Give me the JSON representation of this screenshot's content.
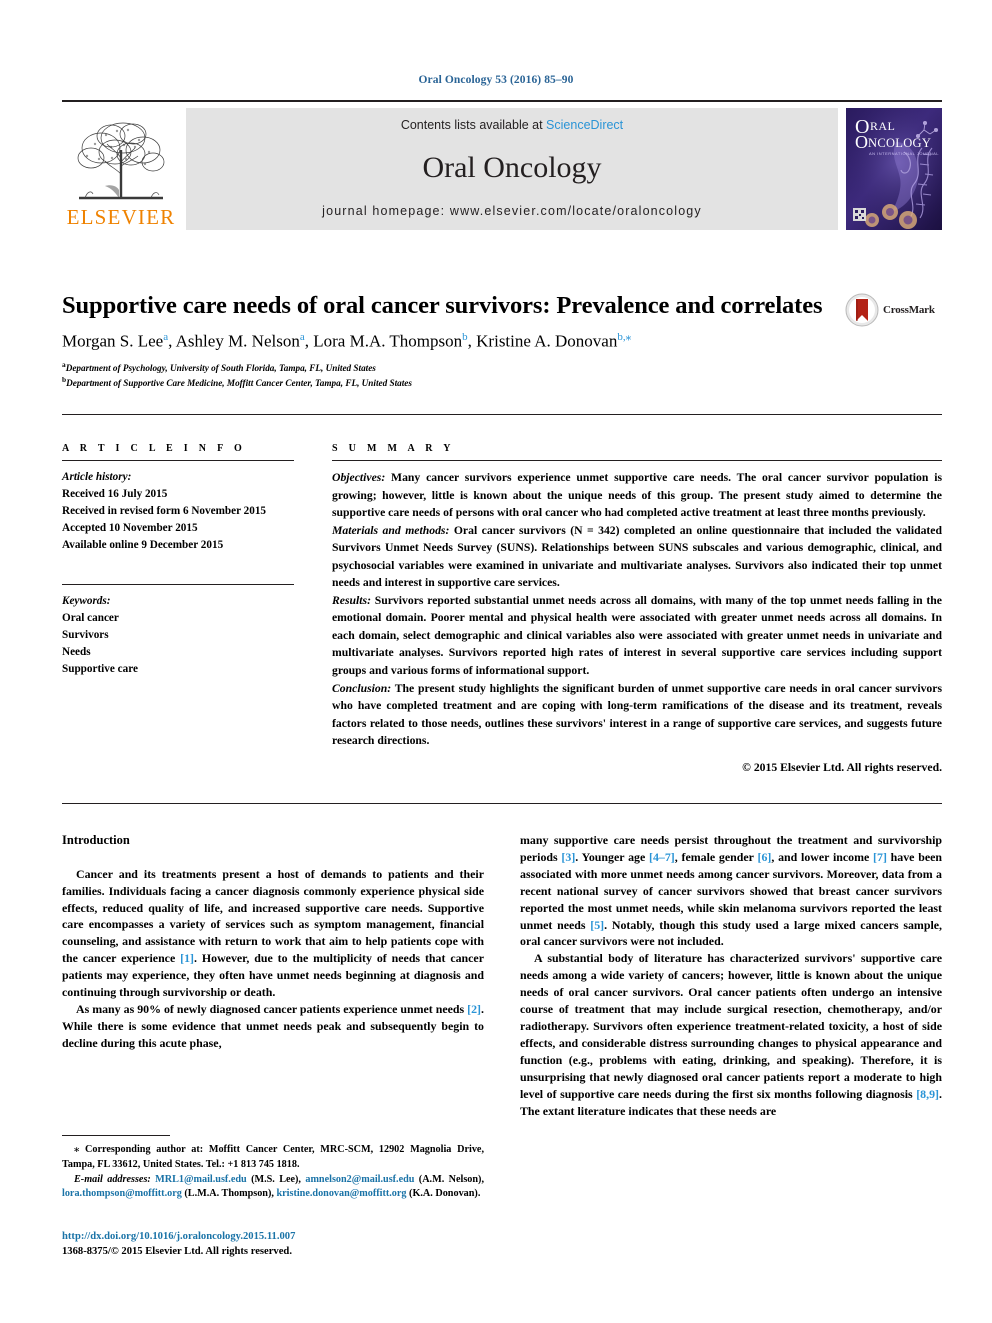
{
  "running_head": "Oral Oncology 53 (2016) 85–90",
  "masthead": {
    "contents_prefix": "Contents lists available at ",
    "contents_link": "ScienceDirect",
    "journal_name": "Oral Oncology",
    "homepage": "journal homepage: www.elsevier.com/locate/oraloncology",
    "publisher_word": "ELSEVIER",
    "cover_line1": "RAL",
    "cover_line2": "NCOLOGY",
    "cover_tagline": "AN INTERNATIONAL JOURNAL",
    "band_color": "#e3e3e3",
    "link_color": "#2a94d6",
    "publisher_color": "#ef8200"
  },
  "article": {
    "title": "Supportive care needs of oral cancer survivors: Prevalence and correlates",
    "crossmark_label": "CrossMark",
    "authors": [
      {
        "name": "Morgan S. Lee",
        "mark": "a",
        "sep": ", "
      },
      {
        "name": "Ashley M. Nelson",
        "mark": "a",
        "sep": ", "
      },
      {
        "name": "Lora M.A. Thompson",
        "mark": "b",
        "sep": ", "
      },
      {
        "name": "Kristine A. Donovan",
        "mark": "b,⁎",
        "sep": ""
      }
    ],
    "affiliations": [
      {
        "mark": "a",
        "text": "Department of Psychology, University of South Florida, Tampa, FL, United States"
      },
      {
        "mark": "b",
        "text": "Department of Supportive Care Medicine, Moffitt Cancer Center, Tampa, FL, United States"
      }
    ]
  },
  "info": {
    "heading": "A R T I C L E  I N F O",
    "history_label": "Article history:",
    "history": [
      "Received 16 July 2015",
      "Received in revised form 6 November 2015",
      "Accepted 10 November 2015",
      "Available online 9 December 2015"
    ],
    "keywords_label": "Keywords:",
    "keywords": [
      "Oral cancer",
      "Survivors",
      "Needs",
      "Supportive care"
    ]
  },
  "summary": {
    "heading": "S U M M A R Y",
    "objectives_label": "Objectives:",
    "objectives": " Many cancer survivors experience unmet supportive care needs. The oral cancer survivor population is growing; however, little is known about the unique needs of this group. The present study aimed to determine the supportive care needs of persons with oral cancer who had completed active treatment at least three months previously.",
    "methods_label": "Materials and methods:",
    "methods": " Oral cancer survivors (N = 342) completed an online questionnaire that included the validated Survivors Unmet Needs Survey (SUNS). Relationships between SUNS subscales and various demographic, clinical, and psychosocial variables were examined in univariate and multivariate analyses. Survivors also indicated their top unmet needs and interest in supportive care services.",
    "results_label": "Results:",
    "results": " Survivors reported substantial unmet needs across all domains, with many of the top unmet needs falling in the emotional domain. Poorer mental and physical health were associated with greater unmet needs across all domains. In each domain, select demographic and clinical variables also were associated with greater unmet needs in univariate and multivariate analyses. Survivors reported high rates of interest in several supportive care services including support groups and various forms of informational support.",
    "conclusion_label": "Conclusion:",
    "conclusion": " The present study highlights the significant burden of unmet supportive care needs in oral cancer survivors who have completed treatment and are coping with long-term ramifications of the disease and its treatment, reveals factors related to those needs, outlines these survivors' interest in a range of supportive care services, and suggests future research directions.",
    "copyright": "© 2015 Elsevier Ltd. All rights reserved."
  },
  "introduction": {
    "heading": "Introduction",
    "left_p1_a": "Cancer and its treatments present a host of demands to patients and their families. Individuals facing a cancer diagnosis commonly experience physical side effects, reduced quality of life, and increased supportive care needs. Supportive care encompasses a variety of services such as symptom management, financial counseling, and assistance with return to work that aim to help patients cope with the cancer experience ",
    "left_p1_ref": "[1]",
    "left_p1_b": ". However, due to the multiplicity of needs that cancer patients may experience, they often have unmet needs beginning at diagnosis and continuing through survivorship or death.",
    "left_p2_a": "As many as 90% of newly diagnosed cancer patients experience unmet needs ",
    "left_p2_ref": "[2]",
    "left_p2_b": ". While there is some evidence that unmet needs peak and subsequently begin to decline during this acute phase,",
    "right_p1_a": "many supportive care needs persist throughout the treatment and survivorship periods ",
    "right_p1_ref1": "[3]",
    "right_p1_b": ". Younger age ",
    "right_p1_ref2": "[4–7]",
    "right_p1_c": ", female gender ",
    "right_p1_ref3": "[6]",
    "right_p1_d": ", and lower income ",
    "right_p1_ref4": "[7]",
    "right_p1_e": " have been associated with more unmet needs among cancer survivors. Moreover, data from a recent national survey of cancer survivors showed that breast cancer survivors reported the most unmet needs, while skin melanoma survivors reported the least unmet needs ",
    "right_p1_ref5": "[5]",
    "right_p1_f": ". Notably, though this study used a large mixed cancers sample, oral cancer survivors were not included.",
    "right_p2_a": "A substantial body of literature has characterized survivors' supportive care needs among a wide variety of cancers; however, little is known about the unique needs of oral cancer survivors. Oral cancer patients often undergo an intensive course of treatment that may include surgical resection, chemotherapy, and/or radiotherapy. Survivors often experience treatment-related toxicity, a host of side effects, and considerable distress surrounding changes to physical appearance and function (e.g., problems with eating, drinking, and speaking). Therefore, it is unsurprising that newly diagnosed oral cancer patients report a moderate to high level of supportive care needs during the first six months following diagnosis ",
    "right_p2_ref": "[8,9]",
    "right_p2_b": ". The extant literature indicates that these needs are"
  },
  "footnotes": {
    "corresponding_mark": "⁎",
    "corresponding": " Corresponding author at: Moffitt Cancer Center, MRC-SCM, 12902 Magnolia Drive, Tampa, FL 33612, United States. Tel.: +1 813 745 1818.",
    "email_label": "E-mail addresses:",
    "emails": [
      {
        "address": "MRL1@mail.usf.edu",
        "owner": " (M.S. Lee), "
      },
      {
        "address": "amnelson2@mail.usf.edu",
        "owner": " (A.M. Nelson), "
      },
      {
        "address": "lora.thompson@moffitt.org",
        "owner": " (L.M.A. Thompson), "
      },
      {
        "address": "kristine.donovan@moffitt.org",
        "owner": " (K.A. Donovan)."
      }
    ]
  },
  "doi": {
    "url": "http://dx.doi.org/10.1016/j.oraloncology.2015.11.007",
    "issn_line": "1368-8375/© 2015 Elsevier Ltd. All rights reserved."
  }
}
